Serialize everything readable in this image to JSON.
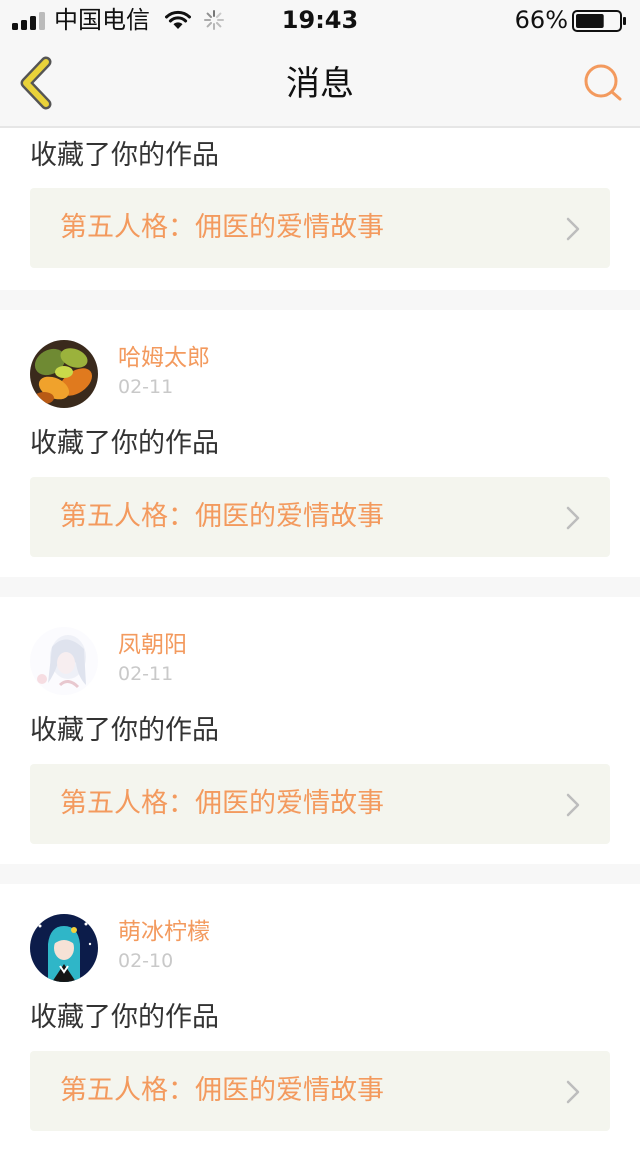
{
  "status_bar": {
    "carrier": "中国电信",
    "time": "19:43",
    "battery_percent": "66%",
    "battery_level": 0.66,
    "icons": [
      "signal-icon",
      "wifi-icon",
      "loading-spinner-icon",
      "battery-icon"
    ]
  },
  "nav": {
    "title": "消息",
    "back_icon": "chevron-left-icon",
    "search_icon": "search-icon"
  },
  "colors": {
    "accent": "#f39a5e",
    "back_icon": "#e9d23a",
    "link_background": "#f4f5ee",
    "separator": "#f7f7f7",
    "date_text": "#c9c9c9"
  },
  "notifications": [
    {
      "action": "收藏了你的作品",
      "work_title": "第五人格：佣医的爱情故事"
    },
    {
      "user": "哈姆太郎",
      "date": "02-11",
      "action": "收藏了你的作品",
      "work_title": "第五人格：佣医的爱情故事"
    },
    {
      "user": "凤朝阳",
      "date": "02-11",
      "action": "收藏了你的作品",
      "work_title": "第五人格：佣医的爱情故事"
    },
    {
      "user": "萌冰柠檬",
      "date": "02-10",
      "action": "收藏了你的作品",
      "work_title": "第五人格：佣医的爱情故事"
    }
  ]
}
